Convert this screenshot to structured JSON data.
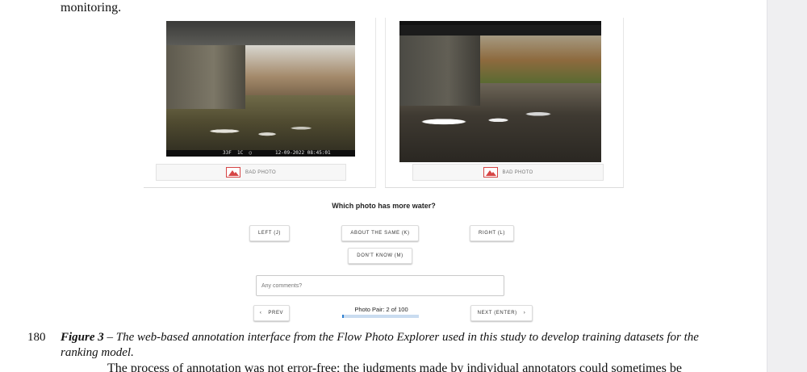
{
  "document": {
    "prev_text": "monitoring.",
    "line_number": "180",
    "caption_label": "Figure 3",
    "caption_text": " – The web-based annotation interface from the Flow Photo Explorer used in this study to develop training datasets for the ranking model.",
    "body_text": "The process of annotation was not error-free; the judgments made by individual annotators could sometimes be"
  },
  "ui": {
    "left_photo": {
      "timestamp": "33F  1C  ○        12-09-2022 08:45:01",
      "bad_photo_label": "BAD PHOTO",
      "bad_photo_icon": "broken-image-icon"
    },
    "right_photo": {
      "bad_photo_label": "BAD PHOTO",
      "bad_photo_icon": "broken-image-icon"
    },
    "question": "Which photo has more water?",
    "buttons": {
      "left": "LEFT (J)",
      "same": "ABOUT THE SAME (K)",
      "right": "RIGHT (L)",
      "dont_know": "DON'T KNOW (M)",
      "prev": "PREV",
      "next": "NEXT (ENTER)"
    },
    "comment_placeholder": "Any comments?",
    "photo_pair_label": "Photo Pair: 2 of 100",
    "progress": {
      "current": 2,
      "total": 100
    },
    "colors": {
      "accent": "#2f80d1",
      "bad_icon": "#d64545"
    }
  }
}
